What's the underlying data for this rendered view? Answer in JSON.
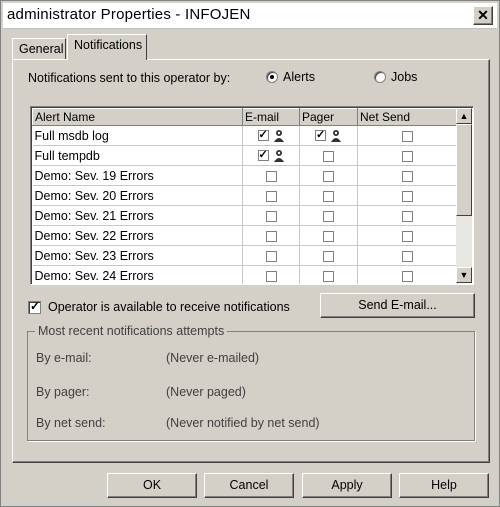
{
  "window": {
    "title": "administrator Properties - INFOJEN",
    "close_glyph": "✕"
  },
  "tabs": [
    {
      "label": "General"
    },
    {
      "label": "Notifications"
    }
  ],
  "notifications": {
    "sent_by_label": "Notifications sent to this operator by:",
    "alerts_label": "Alerts",
    "jobs_label": "Jobs",
    "selected": "Alerts"
  },
  "grid": {
    "columns": [
      "Alert Name",
      "E-mail",
      "Pager",
      "Net Send"
    ],
    "rows": [
      {
        "name": "Full msdb log",
        "email": true,
        "pager": true,
        "netsend": false
      },
      {
        "name": "Full tempdb",
        "email": true,
        "pager": false,
        "netsend": false
      },
      {
        "name": "Demo: Sev. 19 Errors",
        "email": false,
        "pager": false,
        "netsend": false
      },
      {
        "name": "Demo: Sev. 20 Errors",
        "email": false,
        "pager": false,
        "netsend": false
      },
      {
        "name": "Demo: Sev. 21 Errors",
        "email": false,
        "pager": false,
        "netsend": false
      },
      {
        "name": "Demo: Sev. 22 Errors",
        "email": false,
        "pager": false,
        "netsend": false
      },
      {
        "name": "Demo: Sev. 23 Errors",
        "email": false,
        "pager": false,
        "netsend": false
      },
      {
        "name": "Demo: Sev. 24 Errors",
        "email": false,
        "pager": false,
        "netsend": false
      }
    ]
  },
  "available": {
    "label": "Operator is available to receive notifications",
    "checked": true
  },
  "send_email_label": "Send E-mail...",
  "recent": {
    "legend": "Most recent notifications attempts",
    "items": [
      {
        "label": "By e-mail:",
        "value": "(Never e-mailed)"
      },
      {
        "label": "By pager:",
        "value": "(Never paged)"
      },
      {
        "label": "By net send:",
        "value": "(Never notified by net send)"
      }
    ]
  },
  "buttons": {
    "ok": "OK",
    "cancel": "Cancel",
    "apply": "Apply",
    "help": "Help"
  }
}
